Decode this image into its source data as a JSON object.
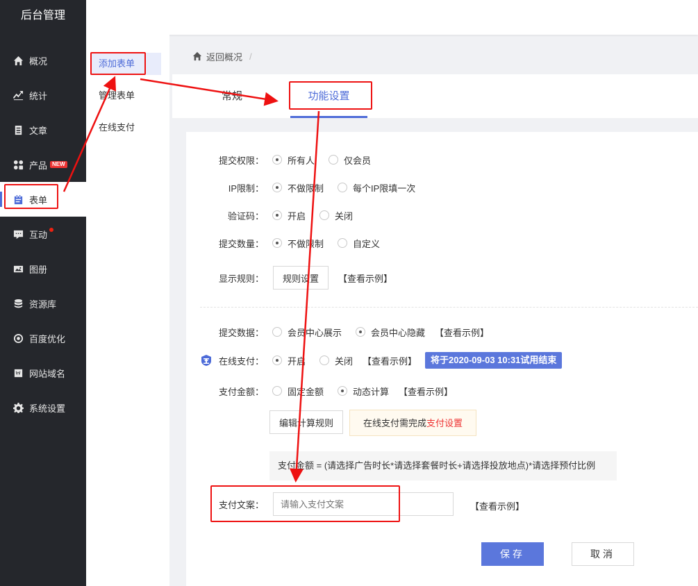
{
  "brand": "后台管理",
  "sidebar": {
    "items": [
      {
        "label": "概况",
        "icon": "home-icon"
      },
      {
        "label": "统计",
        "icon": "stats-icon"
      },
      {
        "label": "文章",
        "icon": "article-icon"
      },
      {
        "label": "产品",
        "icon": "product-icon",
        "badge": "NEW"
      },
      {
        "label": "表单",
        "icon": "form-icon",
        "active": true
      },
      {
        "label": "互动",
        "icon": "chat-icon",
        "dot": true
      },
      {
        "label": "图册",
        "icon": "gallery-icon"
      },
      {
        "label": "资源库",
        "icon": "database-icon"
      },
      {
        "label": "百度优化",
        "icon": "seo-icon"
      },
      {
        "label": "网站域名",
        "icon": "domain-icon"
      },
      {
        "label": "系统设置",
        "icon": "gear-icon"
      }
    ]
  },
  "subnav": {
    "items": [
      {
        "label": "添加表单",
        "active": true
      },
      {
        "label": "管理表单"
      },
      {
        "label": "在线支付"
      }
    ]
  },
  "breadcrumb": {
    "back": "返回概况",
    "sep": "/"
  },
  "tabs": [
    {
      "label": "常规"
    },
    {
      "label": "功能设置",
      "active": true
    }
  ],
  "form": {
    "submit_permission": {
      "label": "提交权限：",
      "options": [
        "所有人",
        "仅会员"
      ],
      "selected": 0
    },
    "ip_limit": {
      "label": "IP限制：",
      "options": [
        "不做限制",
        "每个IP限填一次"
      ],
      "selected": 0
    },
    "captcha": {
      "label": "验证码：",
      "options": [
        "开启",
        "关闭"
      ],
      "selected": 0
    },
    "submit_count": {
      "label": "提交数量：",
      "options": [
        "不做限制",
        "自定义"
      ],
      "selected": 0
    },
    "display_rule": {
      "label": "显示规则：",
      "button": "规则设置",
      "example": "【查看示例】"
    },
    "submit_data": {
      "label": "提交数据：",
      "options": [
        "会员中心展示",
        "会员中心隐藏"
      ],
      "selected": 1,
      "example": "【查看示例】"
    },
    "online_pay": {
      "label": "在线支付：",
      "options": [
        "开启",
        "关闭"
      ],
      "selected": 0,
      "example": "【查看示例】",
      "trial": "将于2020-09-03 10:31试用结束"
    },
    "pay_amount": {
      "label": "支付金额：",
      "options": [
        "固定金额",
        "动态计算"
      ],
      "selected": 1,
      "example": "【查看示例】"
    },
    "edit_rule_button": "编辑计算规则",
    "notice_prefix": "在线支付需完成",
    "notice_link": "支付设置",
    "formula": "支付金额 = (请选择广告时长*请选择套餐时长+请选择投放地点)*请选择预付比例",
    "pay_text": {
      "label": "支付文案：",
      "placeholder": "请输入支付文案",
      "example": "【查看示例】"
    },
    "save": "保存",
    "cancel": "取消"
  },
  "colors": {
    "accent": "#5b77dc",
    "annotation": "#e11111",
    "sidebar_bg": "#25272c"
  }
}
